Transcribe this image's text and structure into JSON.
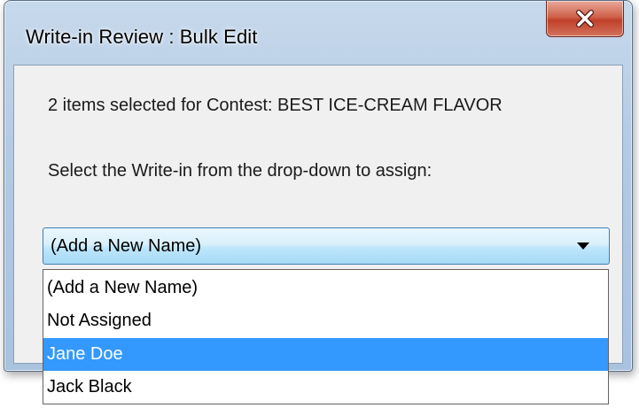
{
  "dialog": {
    "title": "Write-in Review : Bulk Edit",
    "close_icon": "close-icon",
    "message": "2 items selected for Contest: BEST ICE-CREAM FLAVOR",
    "instruction": "Select the Write-in from the drop-down to assign:"
  },
  "writein_select": {
    "selected_value": "(Add a New Name)",
    "arrow_icon": "chevron-down-icon",
    "options": [
      {
        "label": "(Add a New Name)",
        "highlighted": false
      },
      {
        "label": "Not Assigned",
        "highlighted": false
      },
      {
        "label": "Jane Doe",
        "highlighted": true
      },
      {
        "label": "Jack Black",
        "highlighted": false
      }
    ]
  },
  "colors": {
    "highlight": "#3399ff",
    "close_button": "#c7432c",
    "combo_border": "#3c7fb1"
  }
}
